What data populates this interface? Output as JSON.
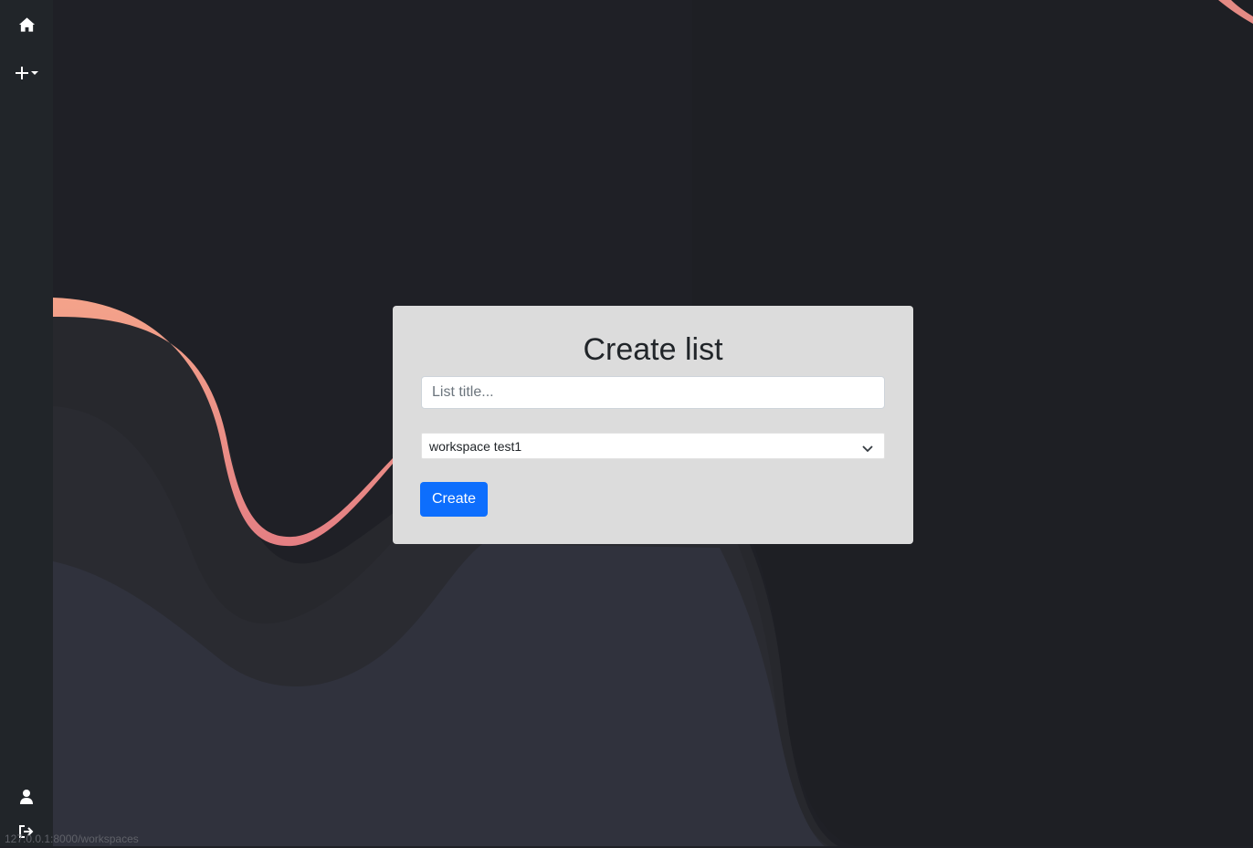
{
  "sidebar": {
    "items": [
      {
        "icon": "home-icon",
        "label": ""
      },
      {
        "icon": "plus-dropdown-icon",
        "label": ""
      },
      {
        "icon": "user-icon",
        "label": ""
      },
      {
        "icon": "logout-icon",
        "label": ""
      }
    ]
  },
  "modal": {
    "title": "Create list",
    "title_placeholder": "List title...",
    "title_value": "",
    "workspace_selected": "workspace test1",
    "create_label": "Create"
  },
  "status_bar": {
    "url": "127.0.0.1:8000/workspaces"
  },
  "colors": {
    "background": "#1f2026",
    "sidebar": "#212529",
    "modal": "#dcdcdc",
    "accent": "#0d6efd",
    "wave_highlight": "#f0907f"
  }
}
